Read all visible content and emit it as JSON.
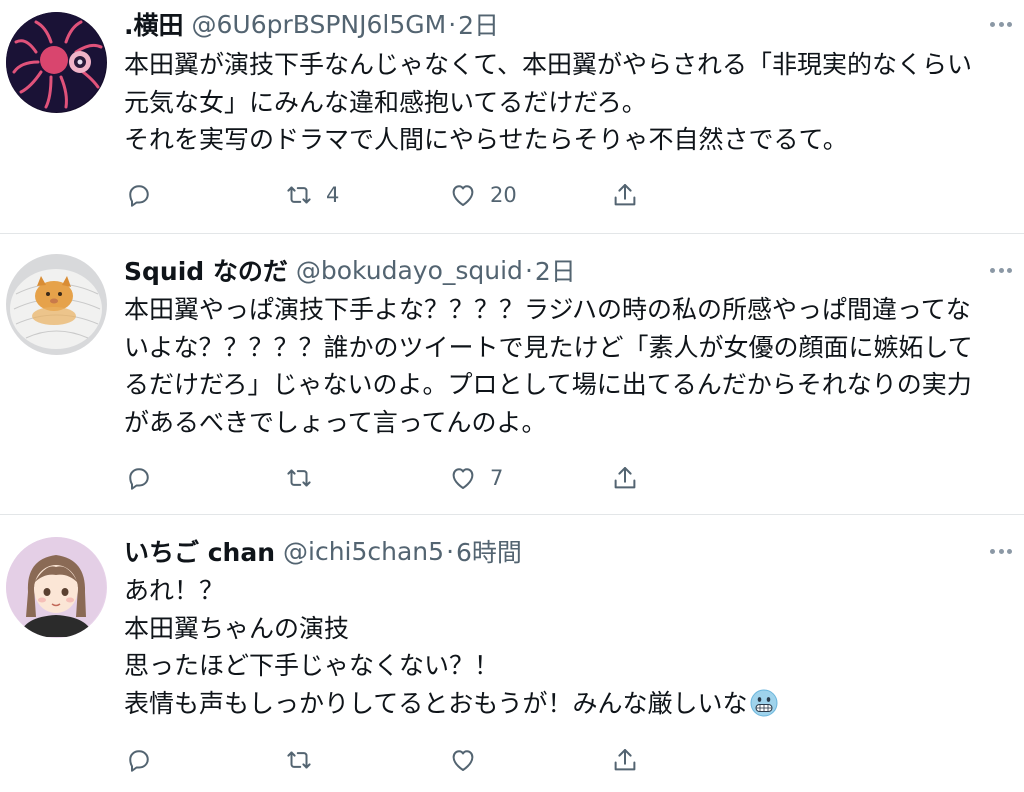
{
  "tweets": [
    {
      "name": ".横田",
      "handle": "@6U6prBSPNJ6l5GM",
      "separator": "·",
      "time": "2日",
      "lines": [
        "本田翼が演技下手なんじゃなくて、本田翼がやらされる「非現実的なくらい",
        "元気な女」にみんな違和感抱いてるだけだろ。",
        "それを実写のドラマで人間にやらせたらそりゃ不自然さでるて。"
      ],
      "retweets": "4",
      "likes": "20"
    },
    {
      "name": "Squid なのだ",
      "handle": "@bokudayo_squid",
      "separator": "·",
      "time": "2日",
      "lines": [
        "本田翼やっぱ演技下手よな？？？？ラジハの時の私の所感やっぱ間違ってな",
        "いよな？？？？？誰かのツイートで見たけど「素人が女優の顔面に嫉妬して",
        "るだけだろ」じゃないのよ。プロとして場に出てるんだからそれなりの実力",
        "があるべきでしょって言ってんのよ。"
      ],
      "retweets": "",
      "likes": "7"
    },
    {
      "name": "いちご chan",
      "handle": "@ichi5chan5",
      "separator": "·",
      "time": "6時間",
      "lines": [
        "あれ！？",
        "本田翼ちゃんの演技",
        "思ったほど下手じゃなくない？！",
        "表情も声もしっかりしてるとおもうが！みんな厳しいな"
      ],
      "retweets": "",
      "likes": ""
    }
  ],
  "icons": {
    "reply": "reply-icon",
    "retweet": "retweet-icon",
    "like": "like-icon",
    "share": "share-icon",
    "more": "more-icon",
    "emoji": "grimacing-face-emoji"
  },
  "colors": {
    "text": "#0f1419",
    "secondary": "#536471",
    "divider": "#e3e6e8"
  }
}
